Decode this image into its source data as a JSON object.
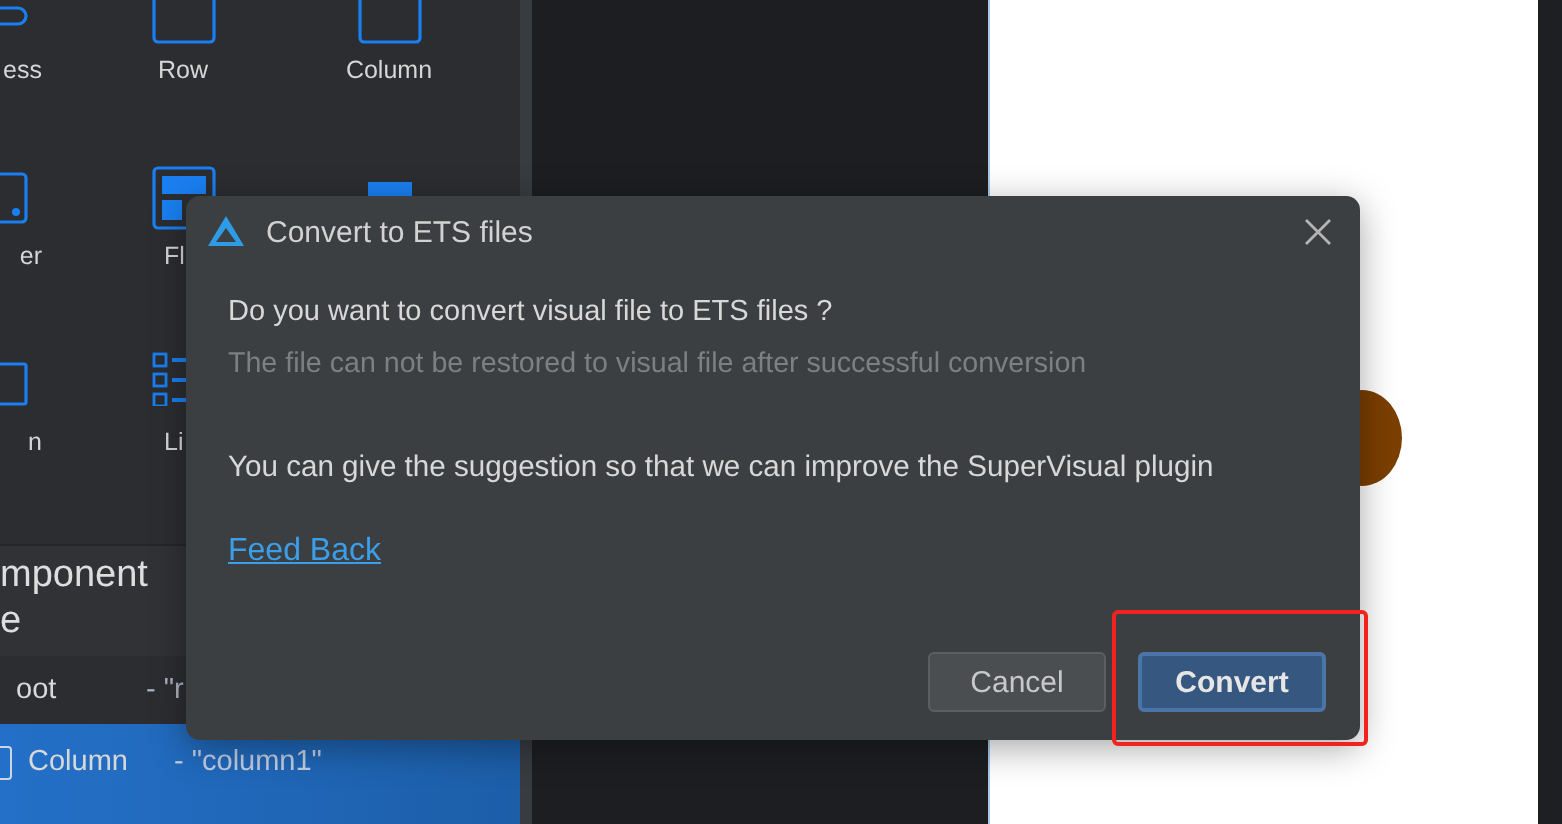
{
  "palette": {
    "items": [
      {
        "label": "ess",
        "kind": "pill"
      },
      {
        "label": "Row",
        "kind": "frame"
      },
      {
        "label": "Column",
        "kind": "frame"
      },
      {
        "label": "er",
        "kind": "dot"
      },
      {
        "label": "Fl",
        "kind": "flex",
        "clipped": true
      },
      {
        "kind": "bar"
      },
      {
        "label": "n",
        "kind": "text"
      },
      {
        "label": "Li",
        "kind": "list",
        "clipped": true
      }
    ]
  },
  "component_tree": {
    "header_lines": [
      "mponent",
      "e"
    ],
    "rows": [
      {
        "name": "oot",
        "id": "- \"r",
        "selected": false,
        "checkbox": false
      },
      {
        "name": "Column",
        "id": "- \"column1\"",
        "selected": true,
        "checkbox": true
      }
    ]
  },
  "dialog": {
    "title": "Convert to ETS files",
    "question": "Do you want to convert visual file to ETS files ?",
    "note": "The file can not be restored to visual file after successful conversion",
    "suggestion": "You can give the suggestion so that we can improve the SuperVisual plugin",
    "link": "Feed Back",
    "buttons": [
      {
        "label": "Cancel",
        "kind": "secondary"
      },
      {
        "label": "Convert",
        "kind": "primary",
        "highlighted": true
      }
    ]
  }
}
